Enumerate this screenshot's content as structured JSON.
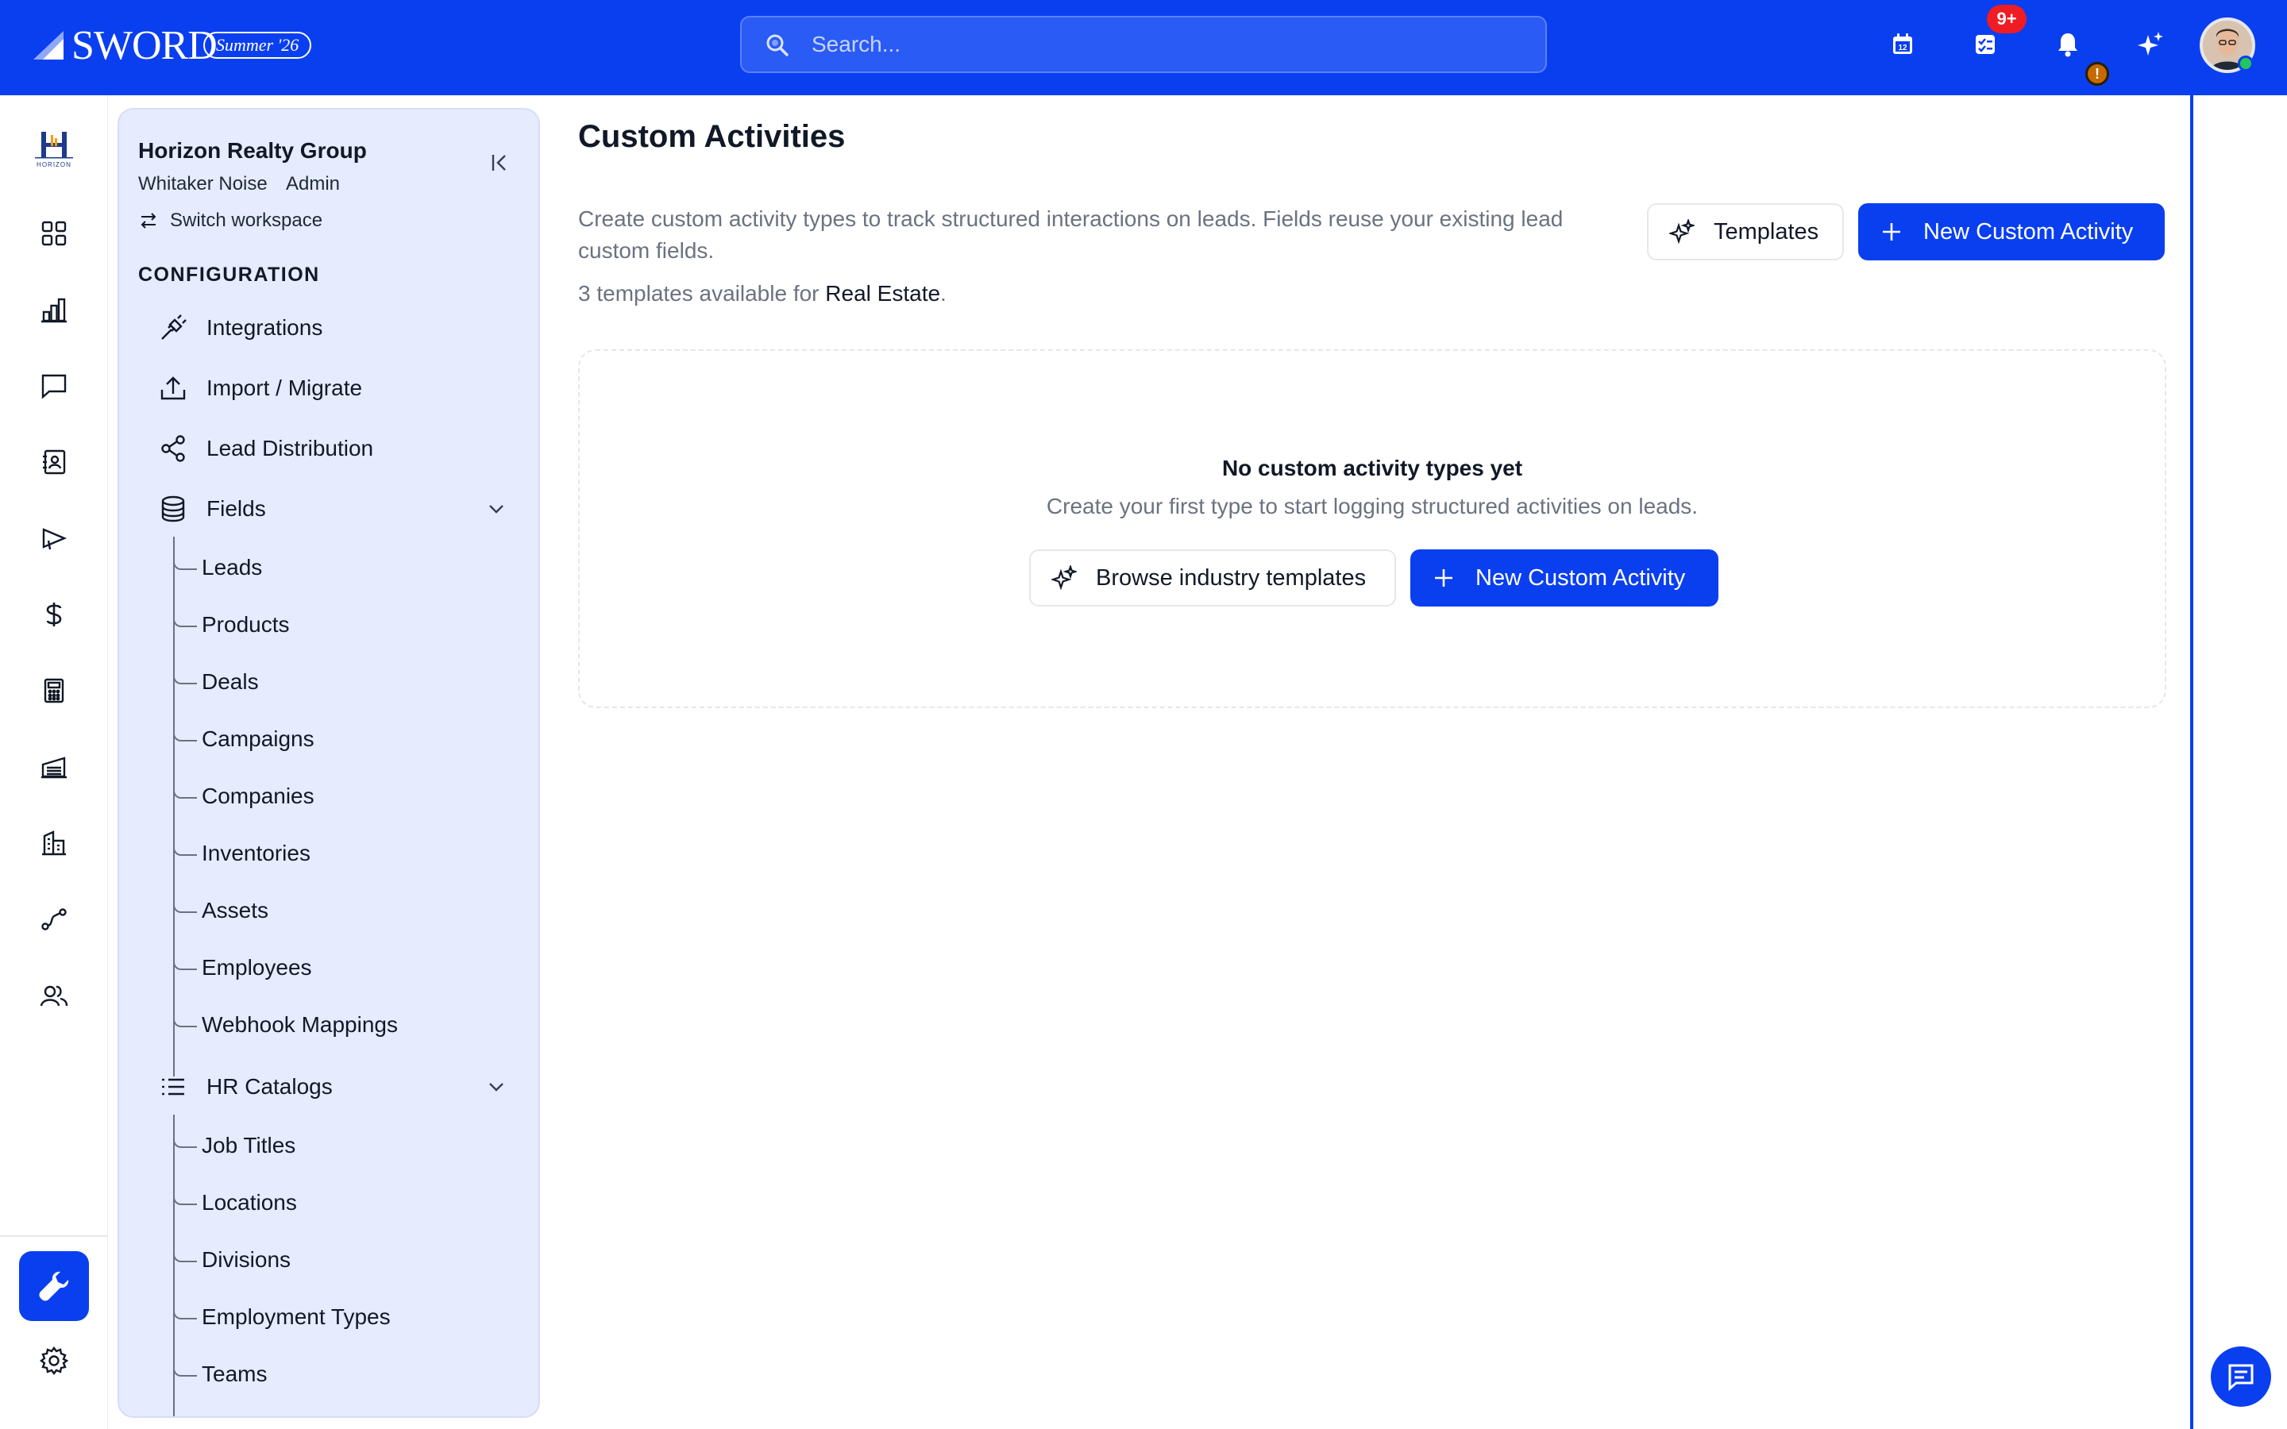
{
  "topbar": {
    "brand": "SWORD",
    "release_tag": "Summer '26",
    "search_placeholder": "Search...",
    "tasks_badge": "9+",
    "alert_badge": "!",
    "icons": [
      "calendar-icon",
      "tasks-icon",
      "bell-icon",
      "sparkle-icon"
    ]
  },
  "rail": {
    "logo_text": "HORIZON",
    "items": [
      "dashboard-icon",
      "analytics-icon",
      "messages-icon",
      "contacts-icon",
      "campaigns-icon",
      "dollar-icon",
      "calculator-icon",
      "warehouse-icon",
      "buildings-icon",
      "routes-icon",
      "team-icon"
    ],
    "bottom": [
      "wrench-icon",
      "settings-icon"
    ]
  },
  "sidebar": {
    "org_name": "Horizon Realty Group",
    "user_name": "Whitaker Noise",
    "user_role": "Admin",
    "switch_label": "Switch workspace",
    "section_title": "CONFIGURATION",
    "items": [
      {
        "label": "Integrations",
        "icon": "plug-icon"
      },
      {
        "label": "Import / Migrate",
        "icon": "upload-icon"
      },
      {
        "label": "Lead Distribution",
        "icon": "share-icon"
      },
      {
        "label": "Fields",
        "icon": "database-icon"
      },
      {
        "label": "HR Catalogs",
        "icon": "list-icon"
      }
    ],
    "fields_children": [
      "Leads",
      "Products",
      "Deals",
      "Campaigns",
      "Companies",
      "Inventories",
      "Assets",
      "Employees",
      "Webhook Mappings"
    ],
    "hr_children": [
      "Job Titles",
      "Locations",
      "Divisions",
      "Employment Types",
      "Teams"
    ]
  },
  "main": {
    "title": "Custom Activities",
    "description": "Create custom activity types to track structured interactions on leads. Fields reuse your existing lead custom fields.",
    "templates_prefix": "3 templates available for",
    "industry": "Real Estate",
    "templates_suffix": ".",
    "templates_button": "Templates",
    "new_button": "New Custom Activity",
    "empty_title": "No custom activity types yet",
    "empty_subtitle": "Create your first type to start logging structured activities on leads.",
    "browse_button": "Browse industry templates",
    "empty_new_button": "New Custom Activity"
  },
  "colors": {
    "brand_blue": "#0a3ff0",
    "panel_bg": "#e6ebfd",
    "badge_red": "#ef1c24",
    "online_green": "#22c55e"
  }
}
